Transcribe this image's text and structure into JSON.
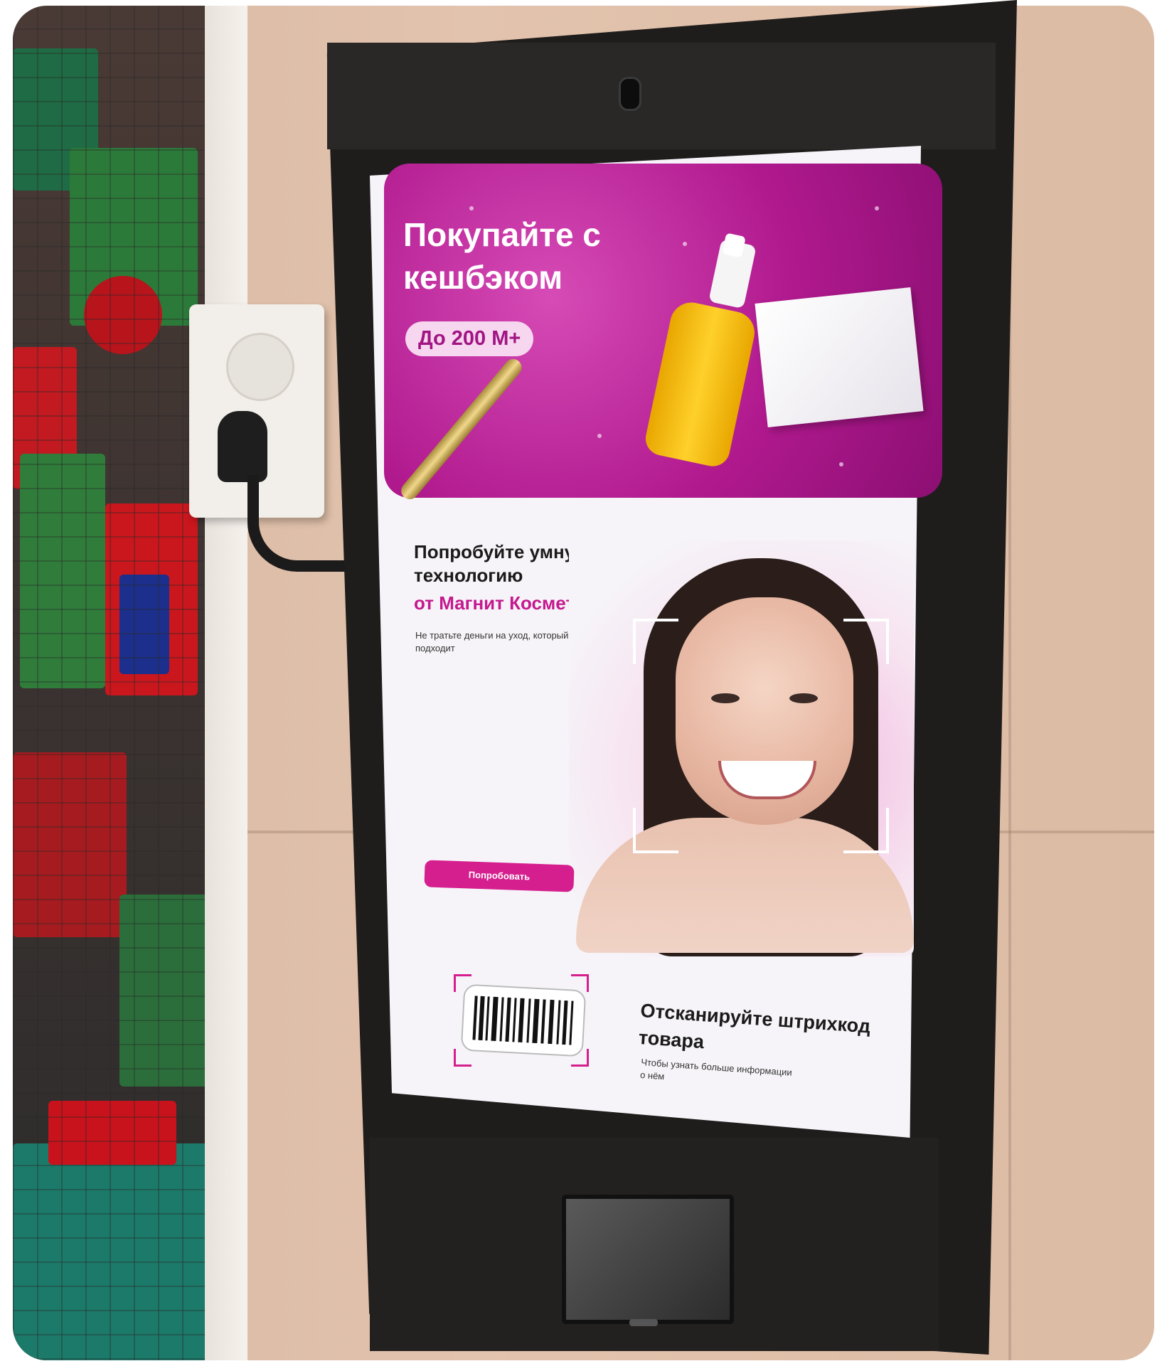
{
  "banner": {
    "title": "Покупайте с кешбэком",
    "badge": "До 200 М+"
  },
  "promo": {
    "title": "Попробуйте умную технологию",
    "brand": "от Магнит Косметик",
    "description": "Не тратьте деньги на уход, который вам не подходит",
    "button_label": "Попробовать"
  },
  "scan": {
    "title": "Отсканируйте штрихкод товара",
    "description": "Чтобы узнать больше информации о нём"
  },
  "icons": {
    "barcode": "barcode-icon",
    "face_scan": "face-scan-frame-icon"
  },
  "colors": {
    "brand_pink": "#d51f8e",
    "banner_magenta": "#b0198e"
  }
}
